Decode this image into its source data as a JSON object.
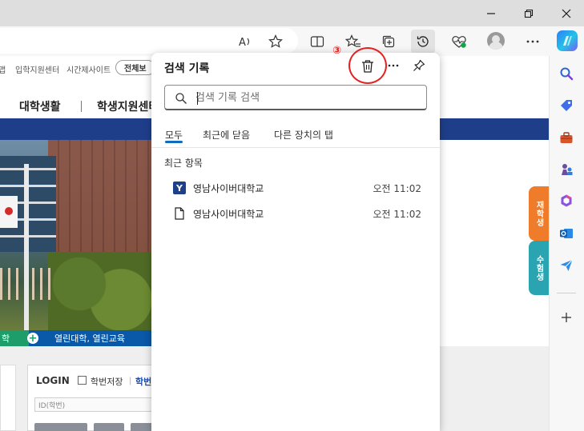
{
  "browser": {
    "address_text": "",
    "sidebar_icons": [
      "search-icon",
      "tag-icon",
      "toolbox-icon",
      "chess-icon",
      "office-icon",
      "outlook-icon",
      "send-icon",
      "add-icon"
    ]
  },
  "page": {
    "top_links": [
      "맵",
      "입학지원센터",
      "시간제사이트"
    ],
    "all_view_label": "전체보",
    "main_nav": [
      "대학생활",
      "학생지원센터"
    ],
    "strip_left": "학",
    "strip_text": "열린대학, 열린교육",
    "side_tab_1": "재학생",
    "side_tab_2": "수험생",
    "login": {
      "title": "LOGIN",
      "save_label": "학번저장",
      "link_label": "학번",
      "id_placeholder": "ID(학번)"
    }
  },
  "history": {
    "title": "검색 기록",
    "step_marker": "③",
    "search_placeholder": "검색 기록 검색",
    "tabs": [
      "모두",
      "최근에 닫음",
      "다른 장치의 탭"
    ],
    "active_tab": "모두",
    "section_title": "최근 항목",
    "items": [
      {
        "title": "영남사이버대학교",
        "time": "오전 11:02",
        "icon": "y-favicon-icon"
      },
      {
        "title": "영남사이버대학교",
        "time": "오전 11:02",
        "icon": "page-icon"
      }
    ]
  },
  "colors": {
    "accent": "#0f6cbd",
    "highlight": "#e32222",
    "nav_blue": "#1f3e8a",
    "tab_orange": "#ef7c2a",
    "tab_teal": "#2ba4b2"
  }
}
